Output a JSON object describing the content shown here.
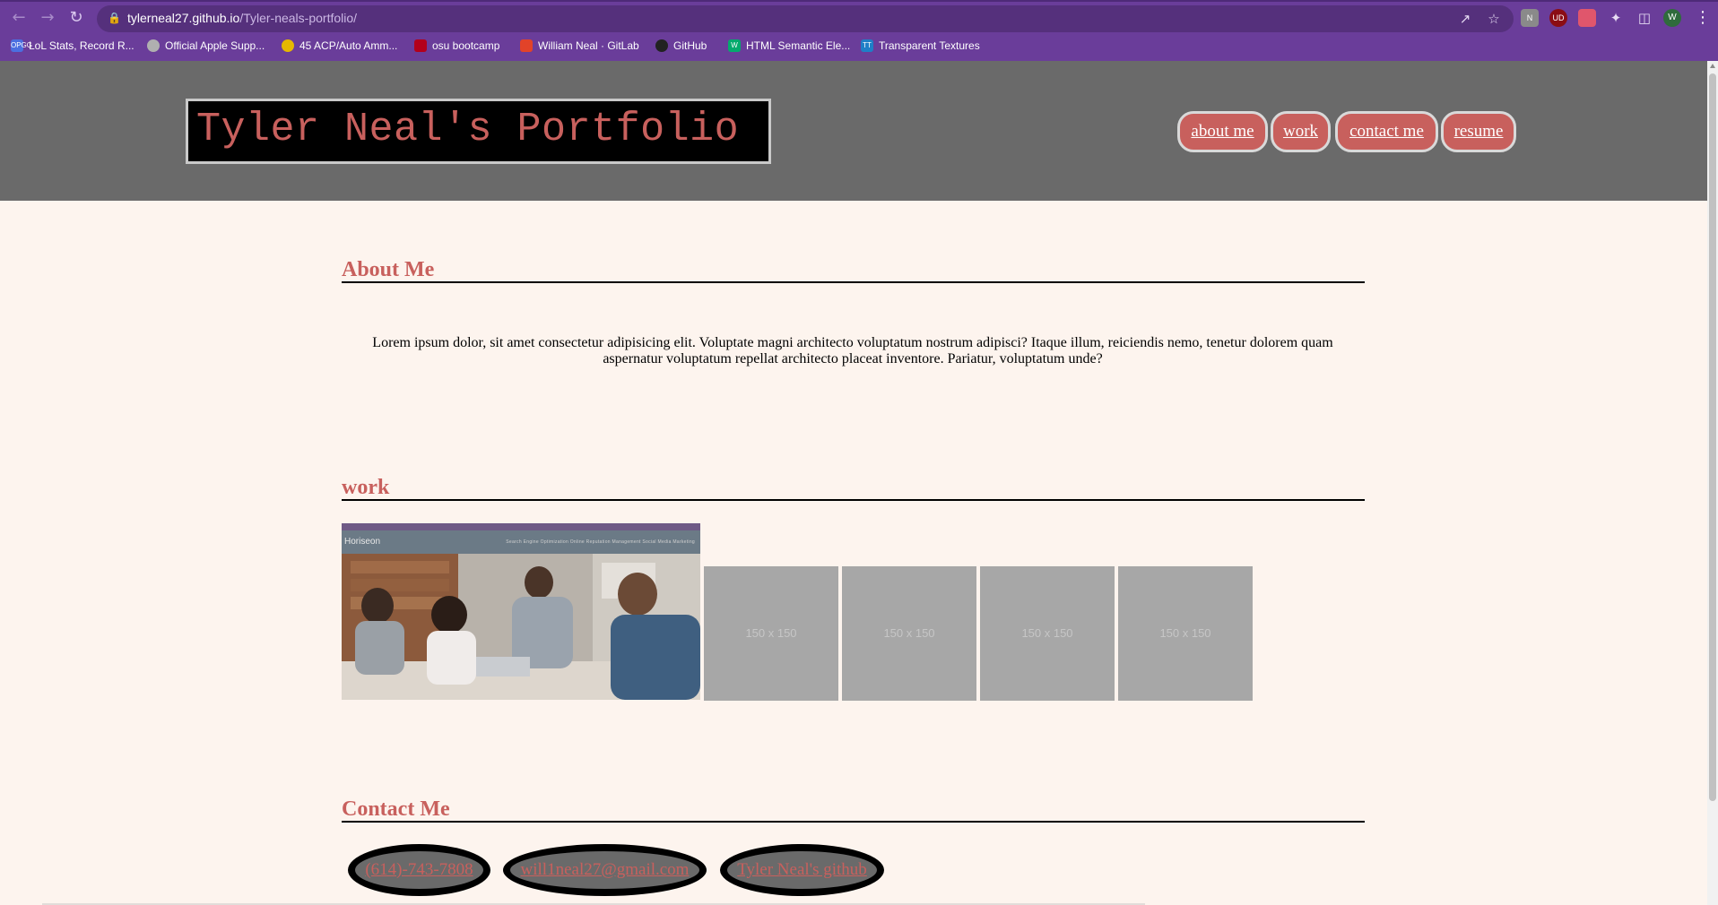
{
  "browser": {
    "url_host": "tylerneal27.github.io",
    "url_path": "/Tyler-neals-portfolio/",
    "profile_initial": "W",
    "icons": {
      "back": "arrow-left-icon",
      "forward": "arrow-right-icon",
      "reload": "reload-icon",
      "lock": "lock-icon",
      "share": "share-icon",
      "star": "star-icon",
      "extensions": "puzzle-icon",
      "sidepanel": "side-panel-icon",
      "menu": "kebab-menu-icon"
    },
    "extension_labels": [
      "N",
      "UD",
      ""
    ],
    "bookmarks": [
      {
        "label": "LoL Stats, Record R...",
        "fav": "OPGG",
        "color": "#4b6fe0"
      },
      {
        "label": "Official Apple Supp...",
        "fav": "",
        "color": "#b0b0b0"
      },
      {
        "label": "45 ACP/Auto Amm...",
        "fav": "",
        "color": "#e6b800"
      },
      {
        "label": "osu bootcamp",
        "fav": "",
        "color": "#b3001b"
      },
      {
        "label": "William Neal · GitLab",
        "fav": "",
        "color": "#e24329"
      },
      {
        "label": "GitHub",
        "fav": "",
        "color": "#222222"
      },
      {
        "label": "HTML Semantic Ele...",
        "fav": "W",
        "color": "#04aa6d"
      },
      {
        "label": "Transparent Textures",
        "fav": "TT",
        "color": "#1f7fc7"
      }
    ],
    "colors": {
      "chrome": "#6a3d9a",
      "omnibox": "#55307c"
    }
  },
  "site": {
    "logo": "Tyler Neal's Portfolio",
    "nav": [
      "about me",
      "work",
      "contact me",
      "resume"
    ],
    "colors": {
      "accent": "#c8605d",
      "header": "#6a6a6a",
      "background": "#fdf4ee"
    }
  },
  "about": {
    "title": "About Me",
    "body": "Lorem ipsum dolor, sit amet consectetur adipisicing elit. Voluptate magni architecto voluptatum nostrum adipisci? Itaque illum, reiciendis nemo, tenetur dolorem quam aspernatur voluptatum repellat architecto placeat inventore. Pariatur, voluptatum unde?"
  },
  "work": {
    "title": "work",
    "featured": {
      "brand": "Horiseon",
      "nav_text": "Search Engine Optimization    Online Reputation Management    Social Media Marketing"
    },
    "placeholders": [
      "150 x 150",
      "150 x 150",
      "150 x 150",
      "150 x 150"
    ]
  },
  "contact": {
    "title": "Contact Me",
    "links": [
      "(614)-743-7808",
      "will1neal27@gmail.com",
      "Tyler Neal's github"
    ]
  }
}
